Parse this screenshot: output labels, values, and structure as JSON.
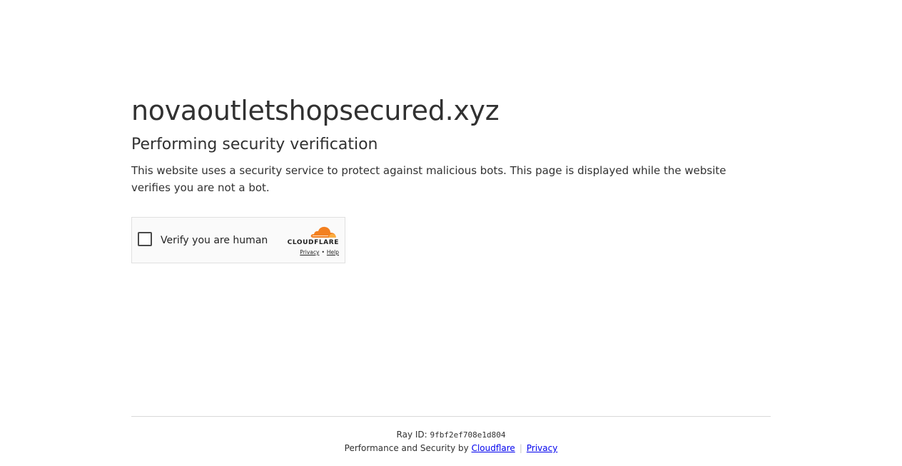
{
  "page": {
    "site_title": "novaoutletshopsecured.xyz",
    "subtitle": "Performing security verification",
    "description": "This website uses a security service to protect against malicious bots. This page is displayed while the website verifies you are not a bot."
  },
  "widget": {
    "checkbox_label": "Verify you are human",
    "checked": false,
    "brand_name": "CLOUDFLARE",
    "brand_icon": "cloudflare-cloud-icon",
    "brand_color": "#f38020",
    "privacy_link": "Privacy",
    "link_separator": "•",
    "help_link": "Help"
  },
  "footer": {
    "ray_label": "Ray ID:",
    "ray_id": "9fbf2ef708e1d804",
    "performance_text": "Performance and Security by",
    "cloudflare_link": "Cloudflare",
    "separator": "|",
    "privacy_link": "Privacy",
    "link_color": "#0000ee"
  }
}
